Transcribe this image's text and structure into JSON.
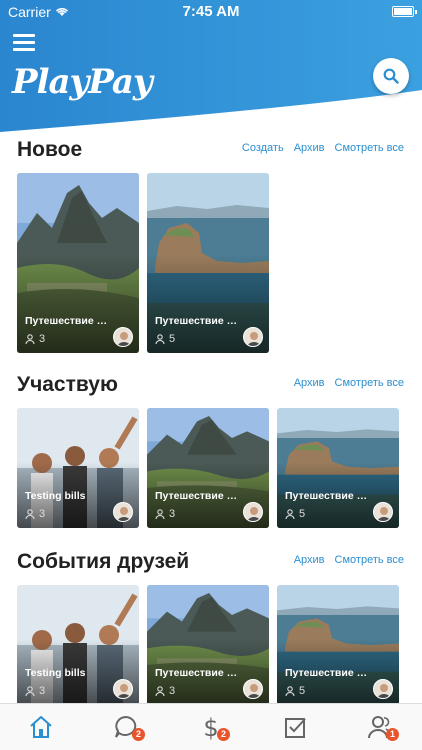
{
  "status_bar": {
    "carrier": "Carrier",
    "time": "7:45 AM"
  },
  "header": {
    "logo": "PlayPay",
    "brand_color": "#2a8fd0"
  },
  "sections": [
    {
      "title": "Новое",
      "links": [
        "Создать",
        "Архив",
        "Смотреть все"
      ],
      "cards": [
        {
          "title": "Путешествие в Перу",
          "count": "3",
          "image": "machu-picchu"
        },
        {
          "title": "Путешествие на Ба...",
          "count": "5",
          "image": "lake-rock"
        }
      ]
    },
    {
      "title": "Участвую",
      "links": [
        "Архив",
        "Смотреть все"
      ],
      "cards": [
        {
          "title": "Testing bills",
          "count": "3",
          "image": "friends"
        },
        {
          "title": "Путешествие в Перу",
          "count": "3",
          "image": "machu-picchu"
        },
        {
          "title": "Путешествие на Ба...",
          "count": "5",
          "image": "lake-rock"
        }
      ]
    },
    {
      "title": "События друзей",
      "links": [
        "Архив",
        "Смотреть все"
      ],
      "cards": [
        {
          "title": "Testing bills",
          "count": "3",
          "image": "friends"
        },
        {
          "title": "Путешествие в Перу",
          "count": "3",
          "image": "machu-picchu"
        },
        {
          "title": "Путешествие на Ба...",
          "count": "5",
          "image": "lake-rock"
        }
      ]
    }
  ],
  "tabbar": {
    "tabs": [
      {
        "icon": "home-icon",
        "active": true
      },
      {
        "icon": "chat-icon",
        "badge": "2"
      },
      {
        "icon": "dollar-icon",
        "badge": "2"
      },
      {
        "icon": "checkbox-icon"
      },
      {
        "icon": "people-icon",
        "badge": "1"
      }
    ]
  }
}
